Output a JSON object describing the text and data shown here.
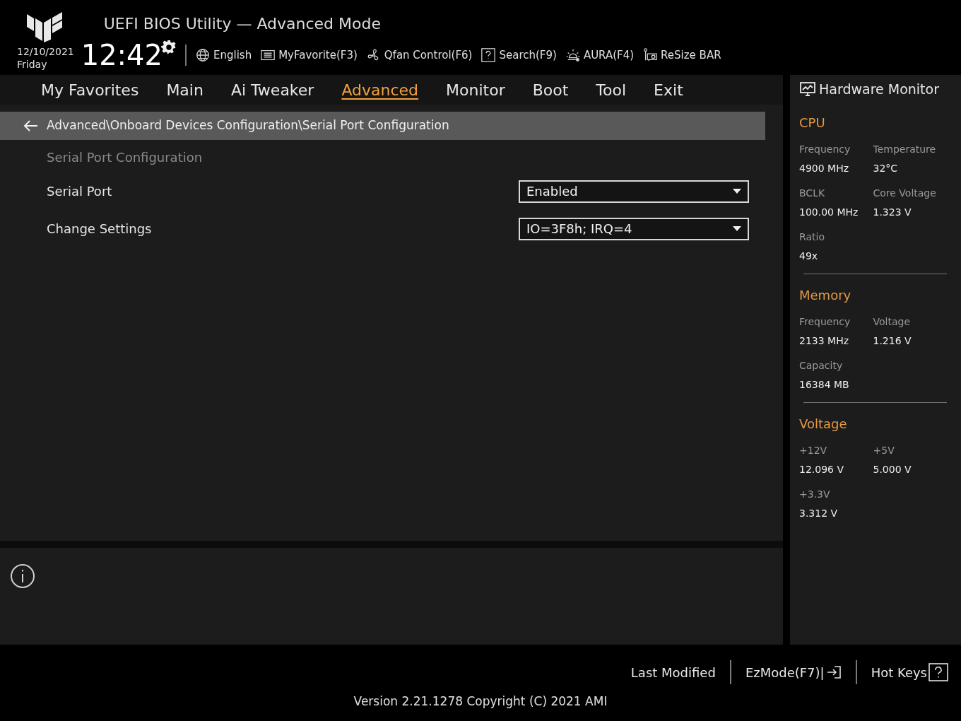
{
  "header": {
    "title": "UEFI BIOS Utility — Advanced Mode",
    "date": "12/10/2021",
    "day": "Friday",
    "time": "12:42",
    "tools": [
      {
        "kind": "language",
        "label": "English"
      },
      {
        "kind": "favorite",
        "label": "MyFavorite(F3)"
      },
      {
        "kind": "fan",
        "label": "Qfan Control(F6)"
      },
      {
        "kind": "search",
        "label": "Search(F9)"
      },
      {
        "kind": "aura",
        "label": "AURA(F4)"
      },
      {
        "kind": "resize",
        "label": "ReSize BAR"
      }
    ]
  },
  "tabs": [
    {
      "label": "My Favorites",
      "selected": false
    },
    {
      "label": "Main",
      "selected": false
    },
    {
      "label": "Ai Tweaker",
      "selected": false
    },
    {
      "label": "Advanced",
      "selected": true
    },
    {
      "label": "Monitor",
      "selected": false
    },
    {
      "label": "Boot",
      "selected": false
    },
    {
      "label": "Tool",
      "selected": false
    },
    {
      "label": "Exit",
      "selected": false
    }
  ],
  "breadcrumb": "Advanced\\Onboard Devices Configuration\\Serial Port Configuration",
  "settings": [
    {
      "kind": "heading",
      "label": "Serial Port Configuration"
    },
    {
      "kind": "dropdown",
      "label": "Serial Port",
      "value": "Enabled"
    },
    {
      "kind": "dropdown",
      "label": "Change Settings",
      "value": "IO=3F8h; IRQ=4"
    }
  ],
  "hardware_monitor": {
    "title": "Hardware Monitor",
    "sections": [
      {
        "title": "CPU",
        "items": [
          {
            "label": "Frequency",
            "value": "4900 MHz"
          },
          {
            "label": "Temperature",
            "value": "32°C"
          },
          {
            "label": "BCLK",
            "value": "100.00 MHz"
          },
          {
            "label": "Core Voltage",
            "value": "1.323 V"
          },
          {
            "label": "Ratio",
            "value": "49x"
          }
        ]
      },
      {
        "title": "Memory",
        "items": [
          {
            "label": "Frequency",
            "value": "2133 MHz"
          },
          {
            "label": "Voltage",
            "value": "1.216 V"
          },
          {
            "label": "Capacity",
            "value": "16384 MB"
          }
        ]
      },
      {
        "title": "Voltage",
        "items": [
          {
            "label": "+12V",
            "value": "12.096 V"
          },
          {
            "label": "+5V",
            "value": "5.000 V"
          },
          {
            "label": "+3.3V",
            "value": "3.312 V"
          }
        ]
      }
    ]
  },
  "footer": {
    "buttons": [
      {
        "kind": "plain",
        "label": "Last Modified"
      },
      {
        "kind": "ezmode",
        "label": "EzMode(F7)|"
      },
      {
        "kind": "hotkeys",
        "label": "Hot Keys"
      }
    ],
    "version": "Version 2.21.1278 Copyright (C) 2021 AMI"
  }
}
